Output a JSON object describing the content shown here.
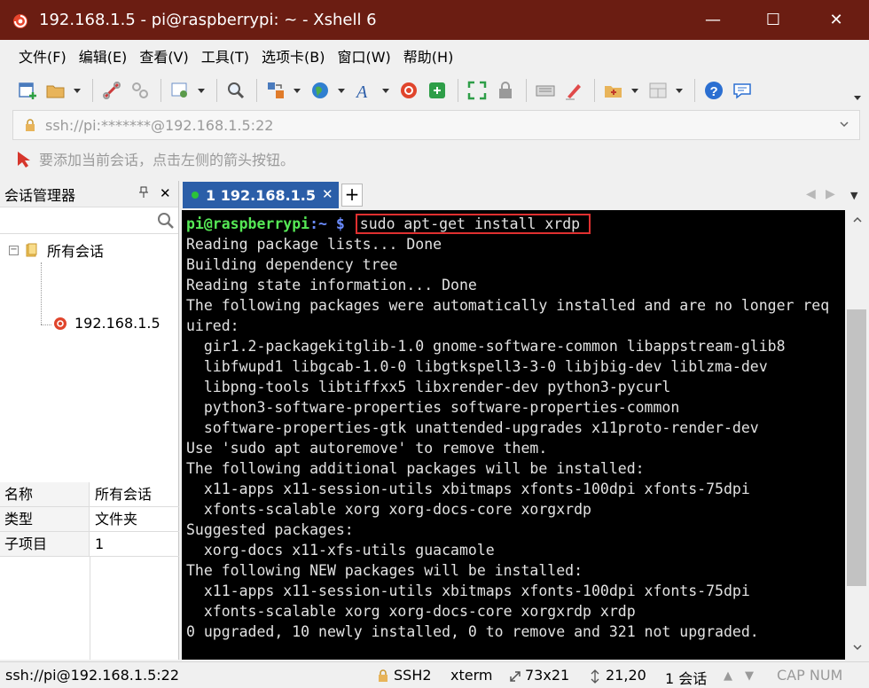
{
  "window": {
    "title": "192.168.1.5 - pi@raspberrypi: ~ - Xshell 6",
    "minimize_glyph": "—",
    "maximize_glyph": "☐",
    "close_glyph": "✕"
  },
  "menu": [
    "文件(F)",
    "编辑(E)",
    "查看(V)",
    "工具(T)",
    "选项卡(B)",
    "窗口(W)",
    "帮助(H)"
  ],
  "toolbar": {
    "icons": [
      "new-session-icon",
      "open-folder-icon",
      "reconnect-icon",
      "disconnect-icon",
      "properties-icon",
      "find-icon",
      "transfer-icon",
      "globe-icon",
      "font-icon",
      "xshell-icon",
      "xftp-icon",
      "fullscreen-icon",
      "lock-icon",
      "keyboard-icon",
      "highlight-icon",
      "new-folder-icon",
      "layout-icon",
      "help-icon",
      "chat-icon"
    ]
  },
  "address": {
    "url": "ssh://pi:*******@192.168.1.5:22"
  },
  "hint": {
    "text": "要添加当前会话，点击左侧的箭头按钮。"
  },
  "session_manager": {
    "title": "会话管理器",
    "pin_glyph": "📌",
    "close_glyph": "✕",
    "tree": {
      "root_label": "所有会话",
      "expander": "−",
      "child_label": "192.168.1.5"
    },
    "properties": [
      {
        "key": "名称",
        "value": "所有会话"
      },
      {
        "key": "类型",
        "value": "文件夹"
      },
      {
        "key": "子项目",
        "value": "1"
      }
    ]
  },
  "tabs": {
    "active_label": "1 192.168.1.5",
    "add_glyph": "+",
    "close_glyph": "✕"
  },
  "terminal": {
    "prompt_user": "pi@raspberrypi",
    "prompt_path": ":~ $",
    "command": "sudo apt-get install xrdp",
    "lines": [
      "Reading package lists... Done",
      "Building dependency tree",
      "Reading state information... Done",
      "The following packages were automatically installed and are no longer req",
      "uired:",
      "  gir1.2-packagekitglib-1.0 gnome-software-common libappstream-glib8",
      "  libfwupd1 libgcab-1.0-0 libgtkspell3-3-0 libjbig-dev liblzma-dev",
      "  libpng-tools libtiffxx5 libxrender-dev python3-pycurl",
      "  python3-software-properties software-properties-common",
      "  software-properties-gtk unattended-upgrades x11proto-render-dev",
      "Use 'sudo apt autoremove' to remove them.",
      "The following additional packages will be installed:",
      "  x11-apps x11-session-utils xbitmaps xfonts-100dpi xfonts-75dpi",
      "  xfonts-scalable xorg xorg-docs-core xorgxrdp",
      "Suggested packages:",
      "  xorg-docs x11-xfs-utils guacamole",
      "The following NEW packages will be installed:",
      "  x11-apps x11-session-utils xbitmaps xfonts-100dpi xfonts-75dpi",
      "  xfonts-scalable xorg xorg-docs-core xorgxrdp xrdp",
      "0 upgraded, 10 newly installed, 0 to remove and 321 not upgraded."
    ]
  },
  "status": {
    "connection": "ssh://pi@192.168.1.5:22",
    "protocol": "SSH2",
    "term": "xterm",
    "size": "73x21",
    "cursor": "21,20",
    "sessions": "1 会话",
    "caps": "CAP NUM"
  },
  "colors": {
    "titlebar": "#6b1d12",
    "tab_active": "#2b5ea8",
    "prompt_user": "#55e855",
    "prompt_path": "#6b8cff",
    "highlight_box": "#e03030"
  }
}
